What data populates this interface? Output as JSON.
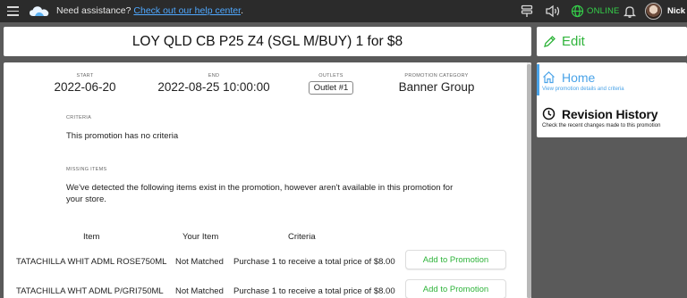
{
  "topbar": {
    "assist_text": "Need assistance?",
    "help_link": "Check out our help center",
    "help_suffix": ".",
    "status": "ONLINE",
    "username": "Nick"
  },
  "promotion": {
    "title": "LOY QLD CB P25 Z4 (SGL M/BUY) 1 for $8",
    "edit_label": "Edit",
    "start_label": "START",
    "start_value": "2022-06-20",
    "end_label": "END",
    "end_value": "2022-08-25 10:00:00",
    "outlets_label": "OUTLETS",
    "outlets_value": "Outlet #1",
    "category_label": "PROMOTION CATEGORY",
    "category_value": "Banner Group"
  },
  "criteria": {
    "label": "CRITERIA",
    "text": "This promotion has no criteria"
  },
  "missing": {
    "label": "MISSING ITEMS",
    "text": "We've detected the following items exist in the promotion, however aren't available in this promotion for your store."
  },
  "table": {
    "headers": [
      "Item",
      "Your Item",
      "Criteria"
    ],
    "rows": [
      {
        "item": "TATACHILLA WHIT ADML ROSE750ML",
        "your_item": "Not Matched",
        "criteria": "Purchase 1 to receive a total price of $8.00",
        "action": "Add to Promotion"
      },
      {
        "item": "TATACHILLA WHT ADML P/GRI750ML",
        "your_item": "Not Matched",
        "criteria": "Purchase 1 to receive a total price of $8.00",
        "action": "Add to Promotion"
      }
    ]
  },
  "nav": {
    "home_title": "Home",
    "home_sub": "View promotion details and criteria",
    "history_title": "Revision History",
    "history_sub": "Check the recent changes made to this promotion"
  },
  "colors": {
    "accent_green": "#2fb43b",
    "accent_blue": "#4aa3e8",
    "topbar_bg": "#2b2b2b",
    "link_blue": "#4fa8ff"
  },
  "icons": [
    "menu-icon",
    "cloud-logo-icon",
    "filter-icon",
    "sound-icon",
    "globe-icon",
    "bell-icon",
    "pencil-icon",
    "home-icon",
    "clock-icon"
  ]
}
